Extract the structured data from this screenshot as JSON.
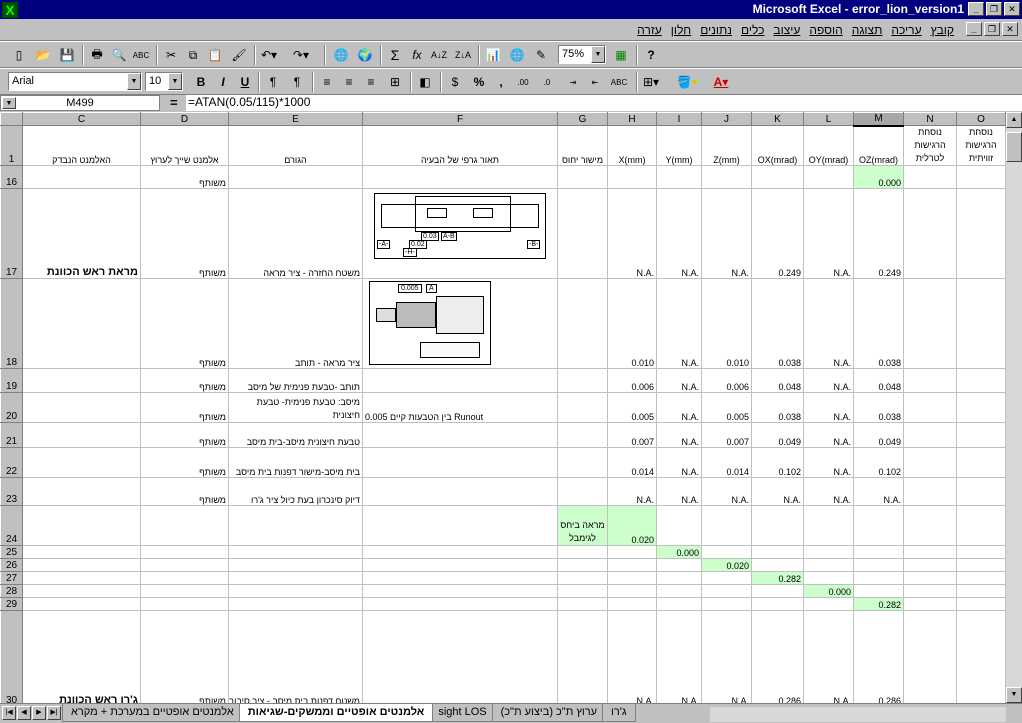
{
  "window": {
    "title": "Microsoft Excel - error_lion_version1",
    "app_icon": "excel-icon"
  },
  "menu": [
    "קובץ",
    "עריכה",
    "תצוגה",
    "הוספה",
    "עיצוב",
    "כלים",
    "נתונים",
    "חלון",
    "עזרה"
  ],
  "toolbar": {
    "zoom": "75%",
    "font": "Arial",
    "size": "10",
    "bold": "B",
    "italic": "I",
    "underline": "U",
    "percent": "%",
    "abc": "ABC"
  },
  "formula": {
    "cell": "M499",
    "eq": "=",
    "value": "=ATAN(0.05/115)*1000"
  },
  "columns": [
    "C",
    "D",
    "E",
    "F",
    "G",
    "H",
    "I",
    "J",
    "K",
    "L",
    "M",
    "N",
    "O"
  ],
  "header_row": {
    "num": "1",
    "C": "האלמנט הנבדק",
    "D": "אלמנט שייך לערוץ",
    "E": "הגורם",
    "F": "תאור גרפי של הבעיה",
    "G": "מישור יחוס",
    "H": "X(mm)",
    "I": "Y(mm)",
    "J": "Z(mm)",
    "K": "OX(mrad)",
    "L": "OY(mrad)",
    "M": "OZ(mrad)",
    "N": "נוסחת הרגישות לטרלית",
    "O": "נוסחת הרגישות זוויתית"
  },
  "rows": [
    {
      "num": "16",
      "C": "",
      "D": "משותף",
      "E": "",
      "F": "",
      "G": "",
      "H": "",
      "I": "",
      "J": "",
      "K": "",
      "L": "",
      "M": "0.000"
    },
    {
      "num": "17",
      "C": "מראת ראש הכוונת",
      "D": "משותף",
      "E": "משטח החזרה - ציר מראה",
      "F": "",
      "G": "",
      "H": "N.A.",
      "I": "N.A.",
      "J": "N.A.",
      "K": "0.249",
      "L": "N.A.",
      "M": "0.249"
    },
    {
      "num": "18",
      "C": "",
      "D": "משותף",
      "E": "ציר מראה - תותב",
      "F": "",
      "G": "",
      "H": "0.010",
      "I": "N.A.",
      "J": "0.010",
      "K": "0.038",
      "L": "N.A.",
      "M": "0.038"
    },
    {
      "num": "19",
      "C": "",
      "D": "משותף",
      "E": "תותב -טבעת פנימית של מיסב",
      "F": "",
      "G": "",
      "H": "0.006",
      "I": "N.A.",
      "J": "0.006",
      "K": "0.048",
      "L": "N.A.",
      "M": "0.048"
    },
    {
      "num": "20",
      "C": "",
      "D": "משותף",
      "E": "מיסב: טבעת פנימית- טבעת חיצונית",
      "F": "בין הטבעות קיים 0.005 Runout",
      "G": "",
      "H": "0.005",
      "I": "N.A.",
      "J": "0.005",
      "K": "0.038",
      "L": "N.A.",
      "M": "0.038"
    },
    {
      "num": "21",
      "C": "",
      "D": "משותף",
      "E": "טבעת חיצונית מיסב-בית מיסב",
      "F": "",
      "G": "",
      "H": "0.007",
      "I": "N.A.",
      "J": "0.007",
      "K": "0.049",
      "L": "N.A.",
      "M": "0.049"
    },
    {
      "num": "22",
      "C": "",
      "D": "משותף",
      "E": "בית מיסב-מישור דפנות בית מיסב",
      "F": "",
      "G": "",
      "H": "0.014",
      "I": "N.A.",
      "J": "0.014",
      "K": "0.102",
      "L": "N.A.",
      "M": "0.102"
    },
    {
      "num": "23",
      "C": "",
      "D": "משותף",
      "E": "דיוק סינכרון בעת כיול ציר ג'רו",
      "F": "",
      "G": "",
      "H": "N.A.",
      "I": "N.A.",
      "J": "N.A.",
      "K": "N.A.",
      "L": "N.A.",
      "M": "N.A."
    },
    {
      "num": "24",
      "C": "",
      "D": "",
      "E": "",
      "F": "",
      "G": "מראה ביחס לגימבל",
      "H": "0.020",
      "I": "",
      "J": "",
      "K": "",
      "L": "",
      "M": ""
    },
    {
      "num": "25",
      "C": "",
      "D": "",
      "E": "",
      "F": "",
      "G": "",
      "H": "",
      "I": "0.000",
      "J": "",
      "K": "",
      "L": "",
      "M": ""
    },
    {
      "num": "26",
      "C": "",
      "D": "",
      "E": "",
      "F": "",
      "G": "",
      "H": "",
      "I": "",
      "J": "0.020",
      "K": "",
      "L": "",
      "M": ""
    },
    {
      "num": "27",
      "C": "",
      "D": "",
      "E": "",
      "F": "",
      "G": "",
      "H": "",
      "I": "",
      "J": "",
      "K": "0.282",
      "L": "",
      "M": ""
    },
    {
      "num": "28",
      "C": "",
      "D": "",
      "E": "",
      "F": "",
      "G": "",
      "H": "",
      "I": "",
      "J": "",
      "K": "",
      "L": "0.000",
      "M": ""
    },
    {
      "num": "29",
      "C": "",
      "D": "",
      "E": "",
      "F": "",
      "G": "",
      "H": "",
      "I": "",
      "J": "",
      "K": "",
      "L": "",
      "M": "0.282"
    },
    {
      "num": "30",
      "C": "ג'רו ראש הכוונת",
      "D": "משותף",
      "E": "משטח דפנות בית מיסב - ציר סיבוב ג'רו",
      "F": "",
      "G": "",
      "H": "N.A.",
      "I": "N.A.",
      "J": "N.A.",
      "K": "0.286",
      "L": "N.A.",
      "M": "0.286"
    }
  ],
  "drawings": {
    "d17": {
      "t1": "0.03",
      "t2": "A-B",
      "t3": "-A-",
      "t4": "0.02",
      "t5": "-B-",
      "t6": "-H-"
    },
    "d18": {
      "t1": "0.005",
      "t2": "A"
    }
  },
  "sheet_tabs": [
    "אלמנטים אופטיים במערכת + מקרא",
    "אלמנטים אופטיים וממשקים-שגיאות",
    "sight LOS",
    "ערוץ ת\"כ (ביצוע ת\"כ)",
    "ג'רו"
  ],
  "active_tab": 1
}
